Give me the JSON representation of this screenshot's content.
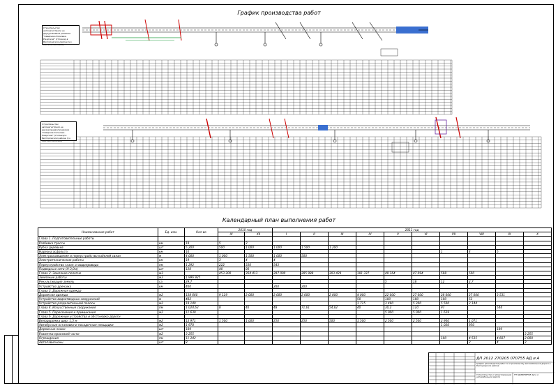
{
  "titles": {
    "main": "График производства работ",
    "calendar": "Календарный план выполнения работ"
  },
  "notes": {
    "top": "Строительство автомагистрали на двухуровневой развязке \"Северное-Сосновка-Ржарское\" (стоянка) в Белгородском районе (уч. ПК0+00-ПК14+00)",
    "middle": "Строительство автомагистрали на двухуровневой развязке \"Северное-Сосновка-Ржарское\" (стоянка) в Белгородском районе (уч. ПК0+00-ПК14+00)"
  },
  "calendar": {
    "headers": {
      "name": "Наименование работ",
      "unit": "Ед. изм.",
      "qty": "Кол-во",
      "year1": "2010 год",
      "year2": "2011 год",
      "months": [
        "XI",
        "XII",
        "I",
        "II",
        "III",
        "IV",
        "V",
        "VI",
        "VII",
        "VIII",
        "IX",
        "X"
      ]
    },
    "rows": [
      {
        "name": "Глава 1. Подготовительные работы",
        "unit": "",
        "qty": "",
        "v": [
          "",
          "",
          "",
          "",
          "",
          "",
          "",
          "",
          "",
          "",
          "",
          ""
        ]
      },
      {
        "name": "Разбивка трассы",
        "unit": "км",
        "qty": "19",
        "v": [
          "5",
          "3",
          "",
          "",
          "",
          "",
          "",
          "",
          "",
          "",
          "",
          ""
        ]
      },
      {
        "name": "Рубка деревьев",
        "unit": "шт",
        "qty": "5 200",
        "v": [
          "500",
          "1 000",
          "1 000",
          "1 500",
          "1 200",
          "",
          "",
          "",
          "",
          "",
          "",
          ""
        ]
      },
      {
        "name": "Нарезка асфальта",
        "unit": "км",
        "qty": "10",
        "v": [
          "",
          "",
          "",
          "",
          "",
          "",
          "",
          "",
          "1",
          "4",
          "5",
          ""
        ]
      },
      {
        "name": "Электроосвещение и переустройство кабелей связи",
        "unit": "м",
        "qty": "4 000",
        "v": [
          "1 000",
          "1 500",
          "1 000",
          "500",
          "",
          "",
          "",
          "",
          "",
          "",
          "",
          ""
        ]
      },
      {
        "name": "Электротехнические работы",
        "unit": "км",
        "qty": "19",
        "v": [
          "3",
          "4",
          "4",
          "",
          "",
          "",
          "",
          "",
          "",
          "",
          "",
          ""
        ]
      },
      {
        "name": "Переустройство газоп. и водопровода",
        "unit": "пм",
        "qty": "1 292",
        "v": [
          "222",
          "330",
          "543",
          "",
          "",
          "",
          "",
          "",
          "",
          "",
          "",
          ""
        ]
      },
      {
        "name": "Подводные сети (Н-3,0м)",
        "unit": "шт",
        "qty": "120",
        "v": [
          "40",
          "80",
          "",
          "",
          "",
          "",
          "",
          "",
          "",
          "",
          "",
          ""
        ]
      },
      {
        "name": "Глава 2. Земляное полотно",
        "unit": "м3",
        "qty": "",
        "v": [
          "453 200",
          "364 413",
          "297 000",
          "285 988",
          "303 429",
          "181 337",
          "49 164",
          "47 094",
          "598",
          "500",
          "",
          ""
        ]
      },
      {
        "name": "Земляные работы",
        "unit": "м3",
        "qty": "1 996 925",
        "v": [
          "",
          "",
          "",
          "",
          "",
          "",
          "",
          "",
          "",
          "",
          "",
          ""
        ]
      },
      {
        "name": "Рекультивация земель",
        "unit": "га",
        "qty": "29,7",
        "v": [
          "",
          "",
          "",
          "",
          "",
          "",
          "5",
          "18",
          "12",
          "2,7",
          "",
          ""
        ]
      },
      {
        "name": "Устройство дренажа",
        "unit": "км",
        "qty": "400",
        "v": [
          "",
          "",
          "200",
          "200",
          "",
          "",
          "",
          "",
          "",
          "",
          "",
          ""
        ]
      },
      {
        "name": "Глава 3. Дорожная одежда",
        "unit": "",
        "qty": "",
        "v": [
          "",
          "",
          "",
          "",
          "",
          "",
          "",
          "",
          "",
          "",
          "",
          ""
        ]
      },
      {
        "name": "Дорожная одежда",
        "unit": "м2",
        "qty": "138 660",
        "v": [
          "9 129",
          "2 000",
          "2 000",
          "2 000",
          "2 000",
          "4 000",
          "22 000",
          "27 000",
          "28 000",
          "27 000",
          "3 531",
          ""
        ]
      },
      {
        "name": "Устройство водоотводных сооружений",
        "unit": "м",
        "qty": "482",
        "v": [
          "",
          "",
          "",
          "",
          "",
          "50",
          "100",
          "180",
          "100",
          "52",
          "",
          ""
        ]
      },
      {
        "name": "Устройство разделительной полосы",
        "unit": "м2",
        "qty": "19 149",
        "v": [
          "",
          "",
          "",
          "",
          "",
          "1 715",
          "3 490",
          "5 300",
          "5 500",
          "3 144",
          "",
          ""
        ]
      },
      {
        "name": "Глава 4. Искусственные сооружения",
        "unit": "пм",
        "qty": "1 024,63",
        "v": [
          "8",
          "40",
          "48",
          "71,61",
          "54,82",
          "40",
          "30,2",
          "110",
          "97",
          "",
          "544",
          ""
        ]
      },
      {
        "name": "Глава 5. Пересечения и примыкания",
        "unit": "м2",
        "qty": "11 639",
        "v": [
          "",
          "",
          "",
          "",
          "",
          "",
          "5 000",
          "5 000",
          "1 639",
          "",
          "",
          ""
        ]
      },
      {
        "name": "Глава 6. Дорожные устройства и обстановка дороги",
        "unit": "",
        "qty": "",
        "v": [
          "",
          "",
          "",
          "",
          "",
          "",
          "",
          "",
          "",
          "",
          "",
          ""
        ]
      },
      {
        "name": "Велодорожка шир. 1,5 м",
        "unit": "м2",
        "qty": "13 971",
        "v": [
          "1 500",
          "1 000",
          "250",
          "250",
          "500",
          "1 500",
          "2 500",
          "2 500",
          "2 900",
          "1 071",
          "",
          ""
        ]
      },
      {
        "name": "Автобусные остановки и посадочные площадки",
        "unit": "м2",
        "qty": "1 970",
        "v": [
          "",
          "",
          "",
          "",
          "",
          "",
          "",
          "",
          "1 020",
          "950",
          "",
          ""
        ]
      },
      {
        "name": "Дорожные знаки",
        "unit": "шт",
        "qty": "189",
        "v": [
          "",
          "",
          "",
          "",
          "",
          "",
          "",
          "",
          "",
          "",
          "189",
          ""
        ]
      },
      {
        "name": "Разметка проезжей части",
        "unit": "м2",
        "qty": "3 255",
        "v": [
          "",
          "",
          "",
          "",
          "",
          "",
          "",
          "",
          "",
          "",
          "",
          "3 255"
        ]
      },
      {
        "name": "Ограждения",
        "unit": "пм",
        "qty": "11 242",
        "v": [
          "",
          "",
          "",
          "",
          "",
          "",
          "",
          "",
          "100",
          "4 535",
          "4 607",
          "2 000"
        ]
      },
      {
        "name": "Автопавильоны",
        "unit": "шт",
        "qty": "8",
        "v": [
          "",
          "",
          "",
          "",
          "",
          "",
          "",
          "",
          "",
          "2",
          "4",
          "2"
        ]
      }
    ]
  },
  "stamp": {
    "code": "ДП 2012 270205 070755 АД и А",
    "title": "График производства работ по строительству автомобильной дороги в Белгородском районе",
    "sheet": "Строительство и проектирование автомобильной дороги",
    "org": "ТГУ ДАМИНИНЧЕ АД и А"
  }
}
